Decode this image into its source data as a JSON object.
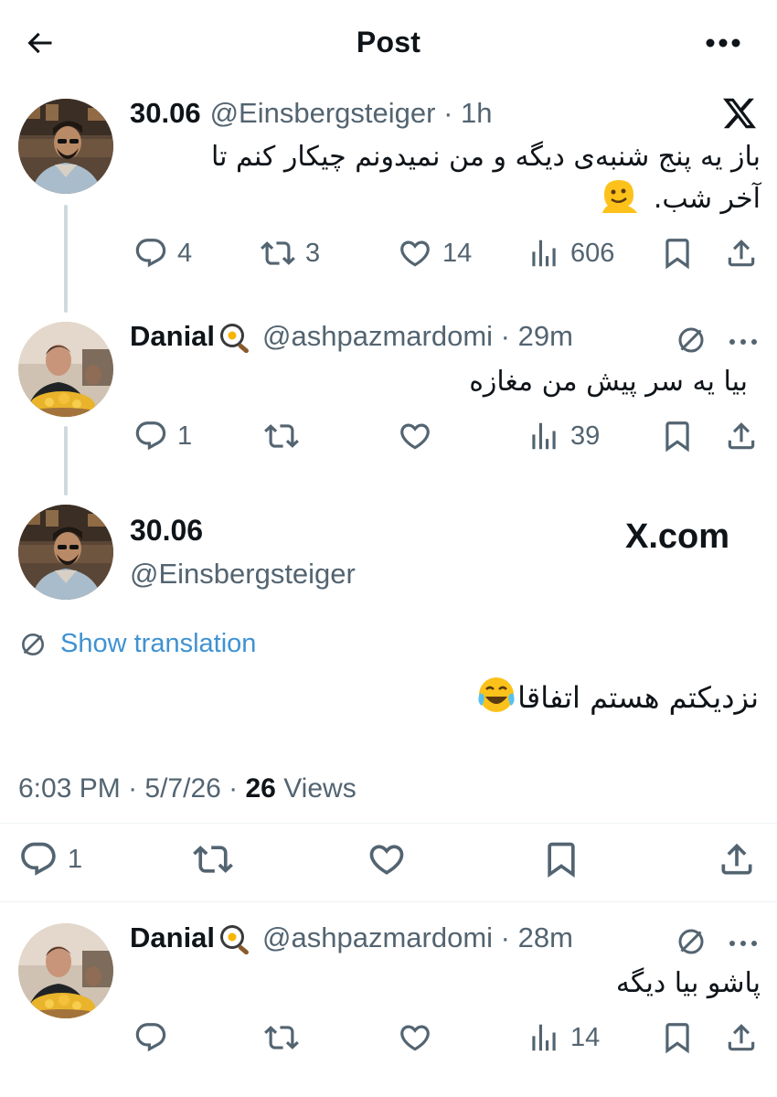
{
  "header": {
    "title": "Post"
  },
  "tweet1": {
    "name": "30.06",
    "handle": "@Einsbergsteiger",
    "time": "1h",
    "text_line1": "باز یه پنج شنبه‌ی دیگه و من نمیدونم چیکار کنم تا",
    "text_line2": "آخر شب.",
    "replies": "4",
    "retweets": "3",
    "likes": "14",
    "views": "606"
  },
  "reply1": {
    "name": "Danial",
    "handle": "@ashpazmardomi",
    "time": "29m",
    "text": "بیا یه سر پیش من مغازه",
    "replies": "1",
    "views": "39"
  },
  "main": {
    "name": "30.06",
    "handle": "@Einsbergsteiger",
    "watermark": "X.com",
    "translate_label": "Show translation",
    "text": "نزدیکتم هستم اتفاقا",
    "time": "6:03 PM",
    "date": "5/7/26",
    "views_count": "26",
    "views_label": "Views",
    "replies": "1"
  },
  "reply2": {
    "name": "Danial",
    "handle": "@ashpazmardomi",
    "time": "28m",
    "text": "پاشو بیا دیگه",
    "views": "14"
  },
  "icons": {
    "back": "arrow-left-icon",
    "more": "more-horizontal-icon",
    "x": "x-logo-icon",
    "reply": "reply-icon",
    "retweet": "retweet-icon",
    "like": "heart-icon",
    "views": "views-icon",
    "bookmark": "bookmark-icon",
    "share": "share-icon",
    "translate": "translate-icon"
  },
  "colors": {
    "text": "#0f1419",
    "secondary": "#536471",
    "link": "#1d9bf0",
    "thread_line": "#cfd9de"
  }
}
